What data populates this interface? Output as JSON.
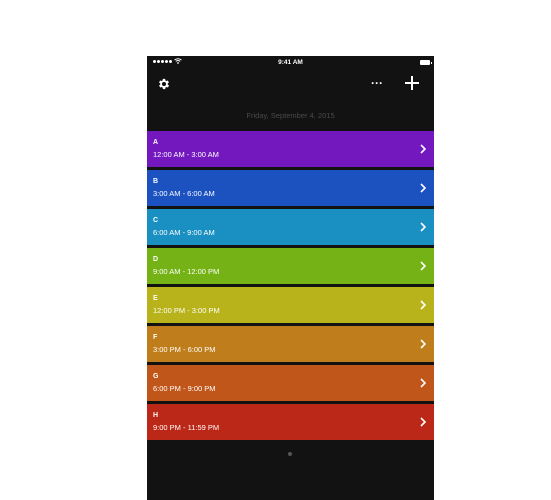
{
  "status_bar": {
    "time": "9:41 AM"
  },
  "nav": {
    "settings_icon": "gear-icon",
    "more_label": "···",
    "add_icon": "plus-icon"
  },
  "date_header": "Friday, September 4, 2015",
  "periods": [
    {
      "letter": "A",
      "time": "12:00 AM - 3:00 AM",
      "color": "#7318be"
    },
    {
      "letter": "B",
      "time": "3:00 AM - 6:00 AM",
      "color": "#1b52c0"
    },
    {
      "letter": "C",
      "time": "6:00 AM - 9:00 AM",
      "color": "#1a8fc1"
    },
    {
      "letter": "D",
      "time": "9:00 AM - 12:00 PM",
      "color": "#74b216"
    },
    {
      "letter": "E",
      "time": "12:00 PM - 3:00 PM",
      "color": "#b8b31a"
    },
    {
      "letter": "F",
      "time": "3:00 PM - 6:00 PM",
      "color": "#bf7e1b"
    },
    {
      "letter": "G",
      "time": "6:00 PM - 9:00 PM",
      "color": "#c1561a"
    },
    {
      "letter": "H",
      "time": "9:00 PM - 11:59 PM",
      "color": "#bb2817"
    }
  ],
  "page_indicator": {
    "count": 1,
    "current": 1
  },
  "colors": {
    "background": "#121212",
    "date_text": "#4a4a4a",
    "text": "#ffffff"
  }
}
